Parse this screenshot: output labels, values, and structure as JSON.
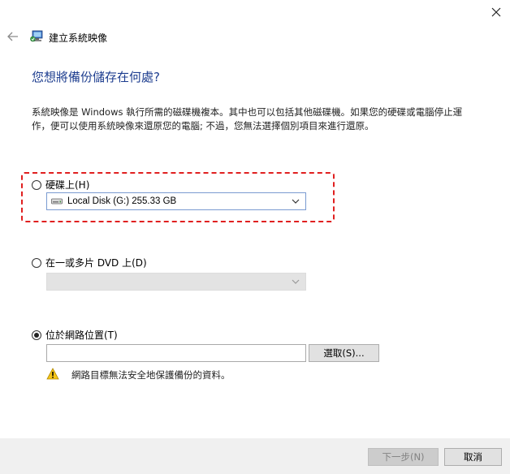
{
  "window": {
    "title": "建立系統映像",
    "close_icon": "close-icon",
    "back_icon": "back-arrow-icon"
  },
  "heading": "您想將備份儲存在何處?",
  "description": "系統映像是 Windows 執行所需的磁碟機複本。其中也可以包括其他磁碟機。如果您的硬碟或電腦停止運作，便可以使用系統映像來還原您的電腦; 不過，您無法選擇個別項目來進行還原。",
  "options": {
    "hard_disk": {
      "label": "硬碟上(H)",
      "selected": false,
      "drive_value": "Local Disk (G:)  255.33 GB"
    },
    "dvd": {
      "label": "在一或多片 DVD 上(D)",
      "selected": false,
      "drive_value": ""
    },
    "network": {
      "label": "位於網路位置(T)",
      "selected": true,
      "path_value": "",
      "browse_label": "選取(S)..."
    }
  },
  "warning": {
    "icon": "warning-icon",
    "text": "網路目標無法安全地保護備份的資料。"
  },
  "footer": {
    "next_label": "下一步(N)",
    "cancel_label": "取消"
  },
  "colors": {
    "heading": "#1d3d8f",
    "highlight_border": "#e02020",
    "footer_bg": "#f0f0f0"
  }
}
